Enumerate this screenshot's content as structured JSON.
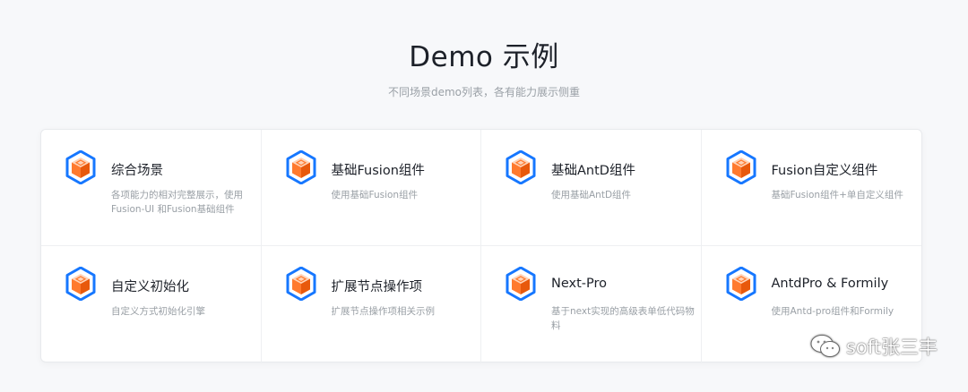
{
  "header": {
    "title": "Demo 示例",
    "subtitle": "不同场景demo列表，各有能力展示侧重"
  },
  "icon": "cube-hexagon-icon",
  "colors": {
    "hex_outer": "#1677ff",
    "cube_left": "#ff7a2e",
    "cube_right": "#e8590c",
    "cube_top": "#ffd4b8"
  },
  "demos": [
    {
      "title": "综合场景",
      "desc": "各项能力的相对完整展示，使用Fusion-UI 和Fusion基础组件"
    },
    {
      "title": "基础Fusion组件",
      "desc": "使用基础Fusion组件"
    },
    {
      "title": "基础AntD组件",
      "desc": "使用基础AntD组件"
    },
    {
      "title": "Fusion自定义组件",
      "desc": "基础Fusion组件+单自定义组件"
    },
    {
      "title": "自定义初始化",
      "desc": "自定义方式初始化引擎"
    },
    {
      "title": "扩展节点操作项",
      "desc": "扩展节点操作项相关示例"
    },
    {
      "title": "Next-Pro",
      "desc": "基于next实现的高级表单低代码物料"
    },
    {
      "title": "AntdPro & Formily",
      "desc": "使用Antd-pro组件和Formily"
    }
  ],
  "watermark": {
    "text": "soft张三丰",
    "icon": "wechat-icon"
  }
}
